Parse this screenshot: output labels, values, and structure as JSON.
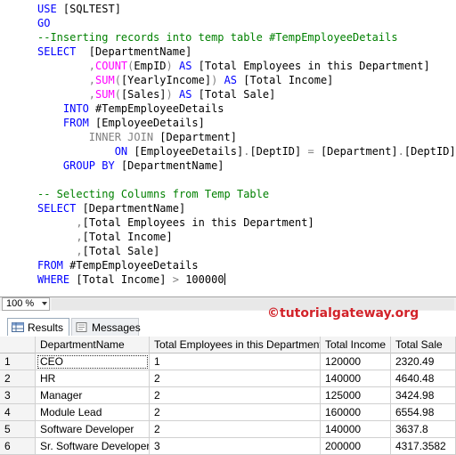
{
  "editor": {
    "lines": [
      [
        {
          "c": "kw",
          "t": "USE "
        },
        {
          "c": "tx",
          "t": "[SQLTEST]"
        }
      ],
      [
        {
          "c": "kw",
          "t": "GO"
        }
      ],
      [
        {
          "c": "cm",
          "t": "--Inserting records into temp table #TempEmployeeDetails"
        }
      ],
      [
        {
          "c": "kw",
          "t": "SELECT  "
        },
        {
          "c": "tx",
          "t": "[DepartmentName]"
        }
      ],
      [
        {
          "c": "tx",
          "t": "        "
        },
        {
          "c": "op",
          "t": ","
        },
        {
          "c": "fn",
          "t": "COUNT"
        },
        {
          "c": "op",
          "t": "("
        },
        {
          "c": "tx",
          "t": "EmpID"
        },
        {
          "c": "op",
          "t": ")"
        },
        {
          "c": "kw",
          "t": " AS "
        },
        {
          "c": "tx",
          "t": "[Total Employees in this Department]"
        }
      ],
      [
        {
          "c": "tx",
          "t": "        "
        },
        {
          "c": "op",
          "t": ","
        },
        {
          "c": "fn",
          "t": "SUM"
        },
        {
          "c": "op",
          "t": "("
        },
        {
          "c": "tx",
          "t": "[YearlyIncome]"
        },
        {
          "c": "op",
          "t": ")"
        },
        {
          "c": "kw",
          "t": " AS "
        },
        {
          "c": "tx",
          "t": "[Total Income]"
        }
      ],
      [
        {
          "c": "tx",
          "t": "        "
        },
        {
          "c": "op",
          "t": ","
        },
        {
          "c": "fn",
          "t": "SUM"
        },
        {
          "c": "op",
          "t": "("
        },
        {
          "c": "tx",
          "t": "[Sales]"
        },
        {
          "c": "op",
          "t": ")"
        },
        {
          "c": "kw",
          "t": " AS "
        },
        {
          "c": "tx",
          "t": "[Total Sale]"
        }
      ],
      [
        {
          "c": "tx",
          "t": "    "
        },
        {
          "c": "kw",
          "t": "INTO "
        },
        {
          "c": "tx",
          "t": "#TempEmployeeDetails"
        }
      ],
      [
        {
          "c": "tx",
          "t": "    "
        },
        {
          "c": "kw",
          "t": "FROM "
        },
        {
          "c": "tx",
          "t": "[EmployeeDetails]"
        }
      ],
      [
        {
          "c": "tx",
          "t": "        "
        },
        {
          "c": "gr",
          "t": "INNER JOIN "
        },
        {
          "c": "tx",
          "t": "[Department]"
        }
      ],
      [
        {
          "c": "tx",
          "t": "            "
        },
        {
          "c": "kw",
          "t": "ON "
        },
        {
          "c": "tx",
          "t": "[EmployeeDetails]"
        },
        {
          "c": "op",
          "t": "."
        },
        {
          "c": "tx",
          "t": "[DeptID] "
        },
        {
          "c": "op",
          "t": "="
        },
        {
          "c": "tx",
          "t": " [Department]"
        },
        {
          "c": "op",
          "t": "."
        },
        {
          "c": "tx",
          "t": "[DeptID]"
        }
      ],
      [
        {
          "c": "tx",
          "t": "    "
        },
        {
          "c": "kw",
          "t": "GROUP BY "
        },
        {
          "c": "tx",
          "t": "[DepartmentName]"
        }
      ],
      [],
      [
        {
          "c": "cm",
          "t": "-- Selecting Columns from Temp Table"
        }
      ],
      [
        {
          "c": "kw",
          "t": "SELECT "
        },
        {
          "c": "tx",
          "t": "[DepartmentName]"
        }
      ],
      [
        {
          "c": "tx",
          "t": "      "
        },
        {
          "c": "op",
          "t": ","
        },
        {
          "c": "tx",
          "t": "[Total Employees in this Department]"
        }
      ],
      [
        {
          "c": "tx",
          "t": "      "
        },
        {
          "c": "op",
          "t": ","
        },
        {
          "c": "tx",
          "t": "[Total Income]"
        }
      ],
      [
        {
          "c": "tx",
          "t": "      "
        },
        {
          "c": "op",
          "t": ","
        },
        {
          "c": "tx",
          "t": "[Total Sale]"
        }
      ],
      [
        {
          "c": "kw",
          "t": "FROM "
        },
        {
          "c": "tx",
          "t": "#TempEmployeeDetails"
        }
      ],
      [
        {
          "c": "kw",
          "t": "WHERE "
        },
        {
          "c": "tx",
          "t": "[Total Income] "
        },
        {
          "c": "op",
          "t": ">"
        },
        {
          "c": "tx",
          "t": " 100000"
        }
      ]
    ]
  },
  "zoom": {
    "value": "100 %"
  },
  "tabs": {
    "results_label": "Results",
    "messages_label": "Messages"
  },
  "watermark": {
    "text": "©tutorialgateway.org"
  },
  "results": {
    "columns": [
      "DepartmentName",
      "Total Employees in this Department",
      "Total Income",
      "Total Sale"
    ],
    "rows": [
      [
        "1",
        "CEO",
        "1",
        "120000",
        "2320.49"
      ],
      [
        "2",
        "HR",
        "2",
        "140000",
        "4640.48"
      ],
      [
        "3",
        "Manager",
        "2",
        "125000",
        "3424.98"
      ],
      [
        "4",
        "Module Lead",
        "2",
        "160000",
        "6554.98"
      ],
      [
        "5",
        "Software Developer",
        "2",
        "140000",
        "3637.8"
      ],
      [
        "6",
        "Sr. Software Developer",
        "3",
        "200000",
        "4317.3582"
      ]
    ]
  },
  "colors": {
    "keyword": "#0000ff",
    "function": "#ff00ff",
    "comment": "#008000",
    "operator": "#808080",
    "watermark": "#d2232a"
  }
}
